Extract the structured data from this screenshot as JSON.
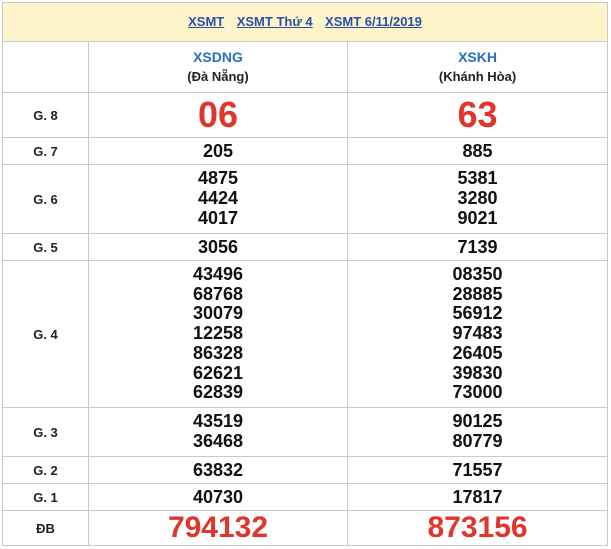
{
  "title_links": [
    "XSMT",
    "XSMT Thứ 4",
    "XSMT 6/11/2019"
  ],
  "provinces": [
    {
      "code": "XSDNG",
      "name": "(Đà Nẵng)"
    },
    {
      "code": "XSKH",
      "name": "(Khánh Hòa)"
    }
  ],
  "prizes": [
    {
      "label": "G. 8",
      "results": [
        [
          "06"
        ],
        [
          "63"
        ]
      ]
    },
    {
      "label": "G. 7",
      "results": [
        [
          "205"
        ],
        [
          "885"
        ]
      ]
    },
    {
      "label": "G. 6",
      "results": [
        [
          "4875",
          "4424",
          "4017"
        ],
        [
          "5381",
          "3280",
          "9021"
        ]
      ]
    },
    {
      "label": "G. 5",
      "results": [
        [
          "3056"
        ],
        [
          "7139"
        ]
      ]
    },
    {
      "label": "G. 4",
      "results": [
        [
          "43496",
          "68768",
          "30079",
          "12258",
          "86328",
          "62621",
          "62839"
        ],
        [
          "08350",
          "28885",
          "56912",
          "97483",
          "26405",
          "39830",
          "73000"
        ]
      ]
    },
    {
      "label": "G. 3",
      "results": [
        [
          "43519",
          "36468"
        ],
        [
          "90125",
          "80779"
        ]
      ]
    },
    {
      "label": "G. 2",
      "results": [
        [
          "63832"
        ],
        [
          "71557"
        ]
      ]
    },
    {
      "label": "G. 1",
      "results": [
        [
          "40730"
        ],
        [
          "17817"
        ]
      ]
    },
    {
      "label": "ĐB",
      "results": [
        [
          "794132"
        ],
        [
          "873156"
        ]
      ]
    }
  ],
  "colors": {
    "accent_red": "#e0352b",
    "link_blue": "#2a4fa8",
    "header_bg": "#fdf5c9"
  }
}
